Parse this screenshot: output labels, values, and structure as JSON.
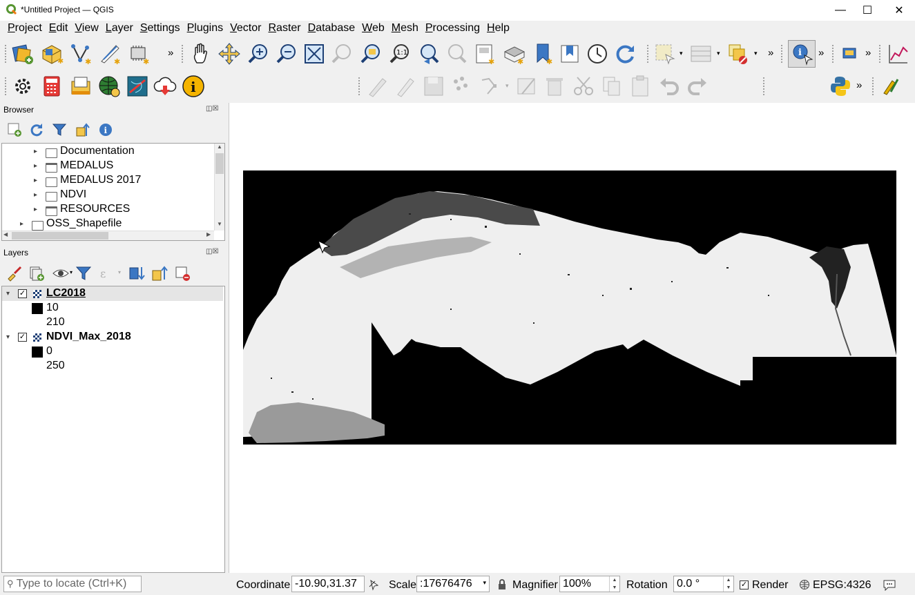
{
  "window": {
    "title": "*Untitled Project — QGIS",
    "min_glyph": "—",
    "max_glyph": "☐",
    "close_glyph": "✕"
  },
  "menubar": [
    "Project",
    "Edit",
    "View",
    "Layer",
    "Settings",
    "Plugins",
    "Vector",
    "Raster",
    "Database",
    "Web",
    "Mesh",
    "Processing",
    "Help"
  ],
  "toolbar_overflow": "»",
  "browser": {
    "title": "Browser",
    "items": [
      {
        "label": "Documentation"
      },
      {
        "label": "MEDALUS"
      },
      {
        "label": "MEDALUS 2017"
      },
      {
        "label": "NDVI"
      },
      {
        "label": "RESOURCES"
      },
      {
        "label": "OSS_Shapefile"
      }
    ]
  },
  "layers": {
    "title": "Layers",
    "items": [
      {
        "name": "LC2018",
        "checked": true,
        "legend": [
          "10",
          "210"
        ]
      },
      {
        "name": "NDVI_Max_2018",
        "checked": true,
        "legend": [
          "0",
          "250"
        ]
      }
    ]
  },
  "statusbar": {
    "locate_placeholder": "Type to locate (Ctrl+K)",
    "coordinate_label": "Coordinate",
    "coordinate_value": "-10.90,31.37",
    "scale_label": "Scale",
    "scale_value": ":17676476",
    "magnifier_label": "Magnifier",
    "magnifier_value": "100%",
    "rotation_label": "Rotation",
    "rotation_value": "0.0 °",
    "render_label": "Render",
    "render_checked": true,
    "crs": "EPSG:4326"
  },
  "colors": {
    "accent_green": "#589632",
    "map_bg": "#000000",
    "land": "#efefef"
  }
}
